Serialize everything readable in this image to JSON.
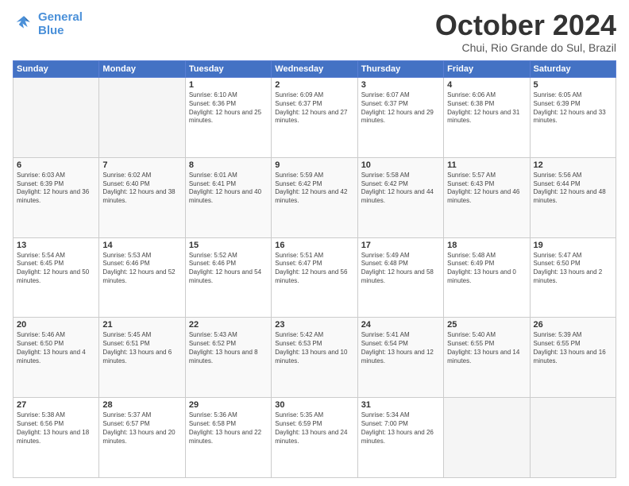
{
  "header": {
    "logo_line1": "General",
    "logo_line2": "Blue",
    "month": "October 2024",
    "location": "Chui, Rio Grande do Sul, Brazil"
  },
  "days_of_week": [
    "Sunday",
    "Monday",
    "Tuesday",
    "Wednesday",
    "Thursday",
    "Friday",
    "Saturday"
  ],
  "weeks": [
    [
      {
        "day": "",
        "empty": true
      },
      {
        "day": "",
        "empty": true
      },
      {
        "day": "1",
        "sunrise": "6:10 AM",
        "sunset": "6:36 PM",
        "daylight": "12 hours and 25 minutes."
      },
      {
        "day": "2",
        "sunrise": "6:09 AM",
        "sunset": "6:37 PM",
        "daylight": "12 hours and 27 minutes."
      },
      {
        "day": "3",
        "sunrise": "6:07 AM",
        "sunset": "6:37 PM",
        "daylight": "12 hours and 29 minutes."
      },
      {
        "day": "4",
        "sunrise": "6:06 AM",
        "sunset": "6:38 PM",
        "daylight": "12 hours and 31 minutes."
      },
      {
        "day": "5",
        "sunrise": "6:05 AM",
        "sunset": "6:39 PM",
        "daylight": "12 hours and 33 minutes."
      }
    ],
    [
      {
        "day": "6",
        "sunrise": "6:03 AM",
        "sunset": "6:39 PM",
        "daylight": "12 hours and 36 minutes."
      },
      {
        "day": "7",
        "sunrise": "6:02 AM",
        "sunset": "6:40 PM",
        "daylight": "12 hours and 38 minutes."
      },
      {
        "day": "8",
        "sunrise": "6:01 AM",
        "sunset": "6:41 PM",
        "daylight": "12 hours and 40 minutes."
      },
      {
        "day": "9",
        "sunrise": "5:59 AM",
        "sunset": "6:42 PM",
        "daylight": "12 hours and 42 minutes."
      },
      {
        "day": "10",
        "sunrise": "5:58 AM",
        "sunset": "6:42 PM",
        "daylight": "12 hours and 44 minutes."
      },
      {
        "day": "11",
        "sunrise": "5:57 AM",
        "sunset": "6:43 PM",
        "daylight": "12 hours and 46 minutes."
      },
      {
        "day": "12",
        "sunrise": "5:56 AM",
        "sunset": "6:44 PM",
        "daylight": "12 hours and 48 minutes."
      }
    ],
    [
      {
        "day": "13",
        "sunrise": "5:54 AM",
        "sunset": "6:45 PM",
        "daylight": "12 hours and 50 minutes."
      },
      {
        "day": "14",
        "sunrise": "5:53 AM",
        "sunset": "6:46 PM",
        "daylight": "12 hours and 52 minutes."
      },
      {
        "day": "15",
        "sunrise": "5:52 AM",
        "sunset": "6:46 PM",
        "daylight": "12 hours and 54 minutes."
      },
      {
        "day": "16",
        "sunrise": "5:51 AM",
        "sunset": "6:47 PM",
        "daylight": "12 hours and 56 minutes."
      },
      {
        "day": "17",
        "sunrise": "5:49 AM",
        "sunset": "6:48 PM",
        "daylight": "12 hours and 58 minutes."
      },
      {
        "day": "18",
        "sunrise": "5:48 AM",
        "sunset": "6:49 PM",
        "daylight": "13 hours and 0 minutes."
      },
      {
        "day": "19",
        "sunrise": "5:47 AM",
        "sunset": "6:50 PM",
        "daylight": "13 hours and 2 minutes."
      }
    ],
    [
      {
        "day": "20",
        "sunrise": "5:46 AM",
        "sunset": "6:50 PM",
        "daylight": "13 hours and 4 minutes."
      },
      {
        "day": "21",
        "sunrise": "5:45 AM",
        "sunset": "6:51 PM",
        "daylight": "13 hours and 6 minutes."
      },
      {
        "day": "22",
        "sunrise": "5:43 AM",
        "sunset": "6:52 PM",
        "daylight": "13 hours and 8 minutes."
      },
      {
        "day": "23",
        "sunrise": "5:42 AM",
        "sunset": "6:53 PM",
        "daylight": "13 hours and 10 minutes."
      },
      {
        "day": "24",
        "sunrise": "5:41 AM",
        "sunset": "6:54 PM",
        "daylight": "13 hours and 12 minutes."
      },
      {
        "day": "25",
        "sunrise": "5:40 AM",
        "sunset": "6:55 PM",
        "daylight": "13 hours and 14 minutes."
      },
      {
        "day": "26",
        "sunrise": "5:39 AM",
        "sunset": "6:55 PM",
        "daylight": "13 hours and 16 minutes."
      }
    ],
    [
      {
        "day": "27",
        "sunrise": "5:38 AM",
        "sunset": "6:56 PM",
        "daylight": "13 hours and 18 minutes."
      },
      {
        "day": "28",
        "sunrise": "5:37 AM",
        "sunset": "6:57 PM",
        "daylight": "13 hours and 20 minutes."
      },
      {
        "day": "29",
        "sunrise": "5:36 AM",
        "sunset": "6:58 PM",
        "daylight": "13 hours and 22 minutes."
      },
      {
        "day": "30",
        "sunrise": "5:35 AM",
        "sunset": "6:59 PM",
        "daylight": "13 hours and 24 minutes."
      },
      {
        "day": "31",
        "sunrise": "5:34 AM",
        "sunset": "7:00 PM",
        "daylight": "13 hours and 26 minutes."
      },
      {
        "day": "",
        "empty": true
      },
      {
        "day": "",
        "empty": true
      }
    ]
  ]
}
